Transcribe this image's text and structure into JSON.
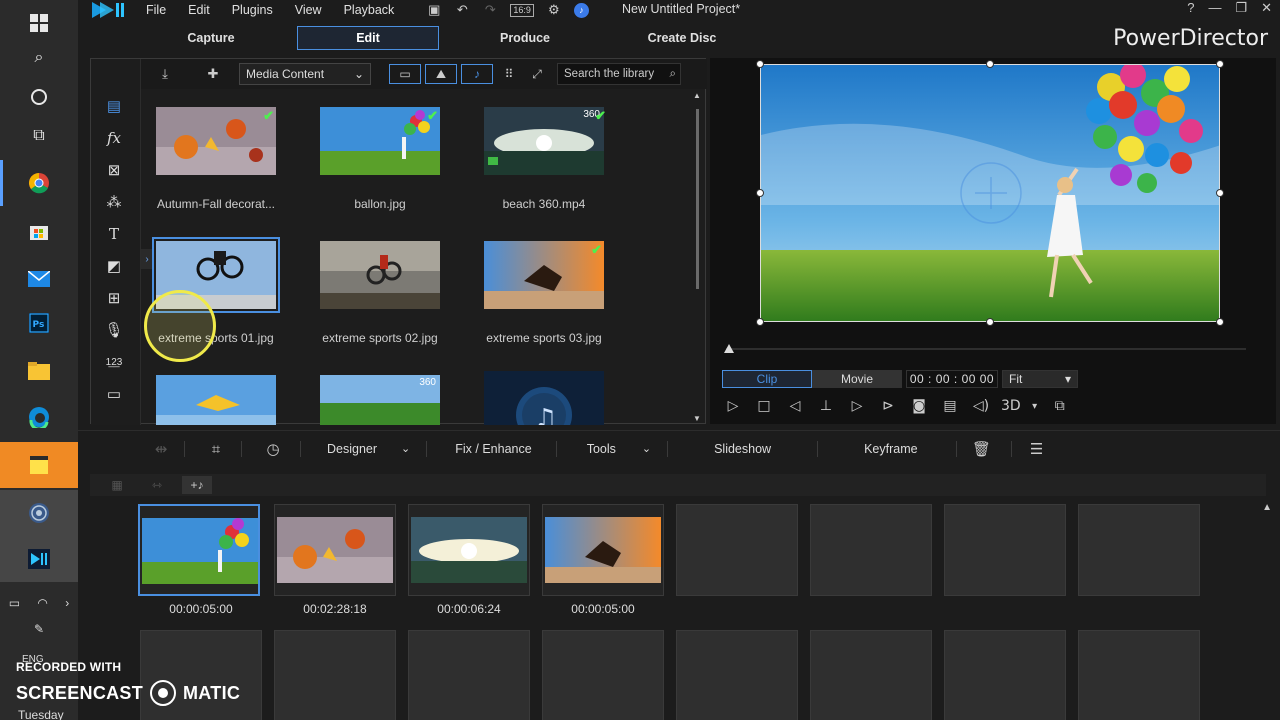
{
  "menu": {
    "file": "File",
    "edit": "Edit",
    "plugins": "Plugins",
    "view": "View",
    "playback": "Playback"
  },
  "quick_toolbar": {
    "ratio": "16:9"
  },
  "project_title": "New Untitled Project*",
  "brand": "PowerDirector",
  "modes": {
    "capture": "Capture",
    "edit": "Edit",
    "produce": "Produce",
    "create_disc": "Create Disc",
    "active": "Edit"
  },
  "library": {
    "dropdown": "Media Content",
    "search_placeholder": "Search the library",
    "items": [
      {
        "label": "Autumn-Fall decorat...",
        "checked": true
      },
      {
        "label": "ballon.jpg",
        "checked": true
      },
      {
        "label": "beach 360.mp4",
        "checked": true,
        "badge": "360"
      },
      {
        "label": "extreme sports 01.jpg",
        "selected": true
      },
      {
        "label": "extreme sports 02.jpg"
      },
      {
        "label": "extreme sports 03.jpg",
        "checked": true
      },
      {
        "label": ""
      },
      {
        "label": "",
        "badge": "360"
      },
      {
        "label": ""
      }
    ]
  },
  "preview": {
    "clip": "Clip",
    "movie": "Movie",
    "active_mode": "Clip",
    "timecode": "00 : 00 : 00  00",
    "fit": "Fit",
    "three_d": "3D"
  },
  "edit_bar": {
    "designer": "Designer",
    "fix_enhance": "Fix / Enhance",
    "tools": "Tools",
    "slideshow": "Slideshow",
    "keyframe": "Keyframe"
  },
  "storyboard": {
    "clips": [
      {
        "duration": "00:00:05:00"
      },
      {
        "duration": "00:02:28:18"
      },
      {
        "duration": "00:00:06:24"
      },
      {
        "duration": "00:00:05:00"
      }
    ]
  },
  "taskbar": {
    "lang": "ENG",
    "day": "Tuesday"
  },
  "watermark": {
    "top": "RECORDED WITH",
    "left": "SCREENCAST",
    "right": "MATIC"
  },
  "colors": {
    "accent": "#4a8fe0",
    "check": "#4ef04e",
    "sticky_notes": "#f08a24"
  }
}
